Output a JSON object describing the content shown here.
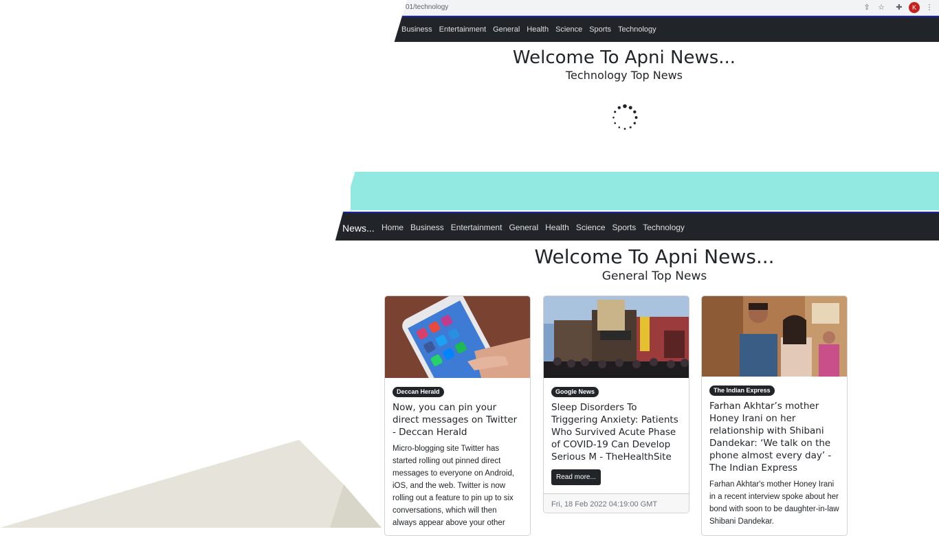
{
  "browser": {
    "url": "01/technology",
    "avatar_letter": "K",
    "icons": [
      "share-icon",
      "star-icon",
      "extensions-icon",
      "menu-icon"
    ]
  },
  "top_section": {
    "nav_items": [
      "Business",
      "Entertainment",
      "General",
      "Health",
      "Science",
      "Sports",
      "Technology"
    ],
    "title": "Welcome To Apni News...",
    "subtitle": "Technology Top News"
  },
  "bottom_section": {
    "brand": "News...",
    "nav_items": [
      "Home",
      "Business",
      "Entertainment",
      "General",
      "Health",
      "Science",
      "Sports",
      "Technology"
    ],
    "title": "Welcome To Apni News...",
    "subtitle": "General Top News"
  },
  "colors": {
    "navbar": "#212529",
    "navbar_accent": "#1a24a8",
    "teal_band": "#91e9e1"
  },
  "cards": [
    {
      "source": "Deccan Herald",
      "title": "Now, you can pin your direct messages on Twitter - Deccan Herald",
      "description": "Micro-blogging site Twitter has started rolling out pinned direct messages to everyone on Android, iOS, and the web. Twitter is now rolling out a feature to pin up to six conversations, which will then always appear above your other"
    },
    {
      "source": "Google News",
      "title": "Sleep Disorders To Triggering Anxiety: Patients Who Survived Acute Phase of COVID-19 Can Develop Serious M - TheHealthSite",
      "button": "Read more...",
      "date": "Fri, 18 Feb 2022 04:19:00 GMT"
    },
    {
      "source": "The Indian Express",
      "title": "Farhan Akhtar’s mother Honey Irani on her relationship with Shibani Dandekar: ‘We talk on the phone almost every day’ - The Indian Express",
      "description": "Farhan Akhtar's mother Honey Irani in a recent interview spoke about her bond with soon to be daughter-in-law Shibani Dandekar."
    }
  ]
}
